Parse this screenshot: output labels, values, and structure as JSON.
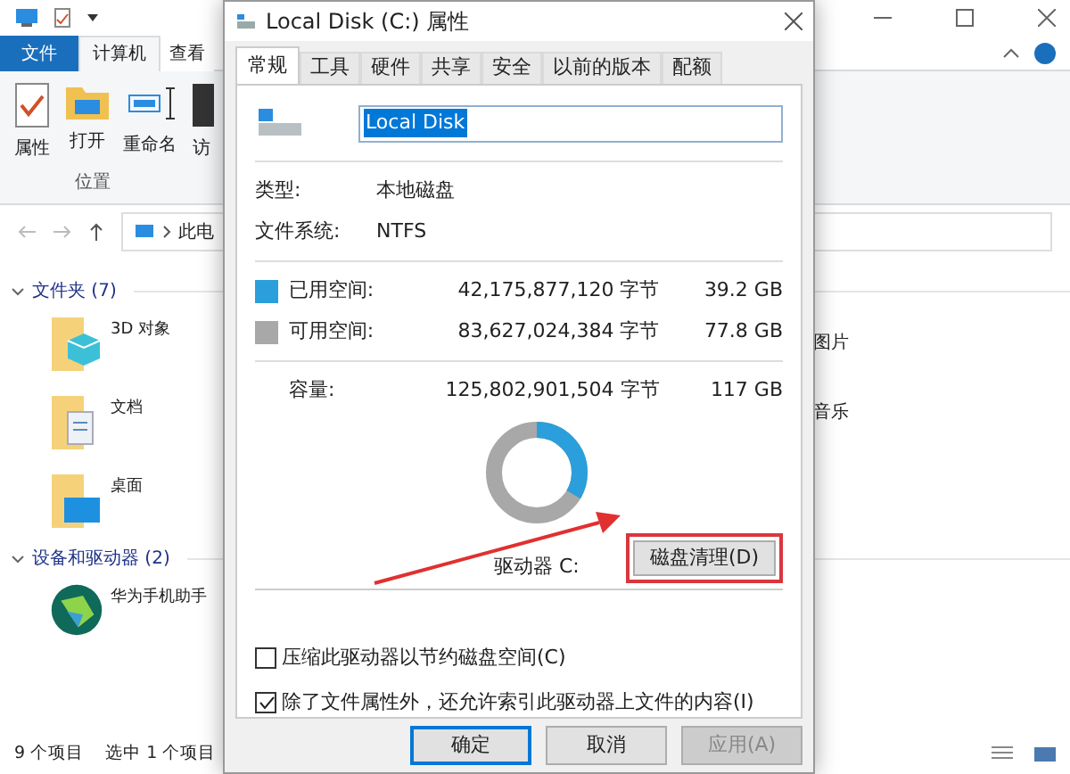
{
  "explorer": {
    "ribbon_tabs": [
      {
        "label": "文件",
        "kind": "file",
        "selected": false
      },
      {
        "label": "计算机",
        "kind": "tab",
        "selected": true
      },
      {
        "label": "查看",
        "kind": "tab",
        "selected": false
      }
    ],
    "ribbon_buttons": [
      {
        "label": "属性",
        "kind": "properties"
      },
      {
        "label": "打开",
        "kind": "open"
      },
      {
        "label": "重命名",
        "kind": "rename"
      },
      {
        "label": "访",
        "kind": "access"
      }
    ],
    "ribbon_group": "位置",
    "address": "此电",
    "sections": [
      {
        "title": "文件夹 (7)",
        "items": [
          {
            "label": "3D 对象",
            "kind": "cube"
          },
          {
            "label": "文档",
            "kind": "docs"
          },
          {
            "label": "桌面",
            "kind": "desktop"
          }
        ],
        "right_items": [
          "图片",
          "音乐"
        ]
      },
      {
        "title": "设备和驱动器 (2)",
        "items": [
          {
            "label": "华为手机助手",
            "kind": "app"
          }
        ]
      }
    ],
    "status": [
      "9 个项目",
      "选中 1 个项目"
    ]
  },
  "dialog": {
    "title": "Local Disk (C:) 属性",
    "tabs": [
      {
        "label": "常规",
        "selected": true
      },
      {
        "label": "工具",
        "selected": false
      },
      {
        "label": "硬件",
        "selected": false
      },
      {
        "label": "共享",
        "selected": false
      },
      {
        "label": "安全",
        "selected": false
      },
      {
        "label": "以前的版本",
        "selected": false
      },
      {
        "label": "配额",
        "selected": false
      }
    ],
    "name_field": {
      "value": "Local Disk"
    },
    "info": [
      {
        "label": "类型:",
        "value": "本地磁盘"
      },
      {
        "label": "文件系统:",
        "value": "NTFS"
      }
    ],
    "space": [
      {
        "label": "已用空间:",
        "bytes": "42,175,877,120 字节",
        "size": "39.2 GB",
        "color": "#2a9fdb"
      },
      {
        "label": "可用空间:",
        "bytes": "83,627,024,384 字节",
        "size": "77.8 GB",
        "color": "#a8a8a8"
      }
    ],
    "capacity": {
      "label": "容量:",
      "bytes": "125,802,901,504 字节",
      "size": "117 GB"
    },
    "usage": {
      "level": 0.335
    },
    "drive_label": "驱动器 C:",
    "cleanup_button": {
      "label": "磁盘清理(D)",
      "highlighted": true
    },
    "checkboxes": [
      {
        "label": "压缩此驱动器以节约磁盘空间(C)",
        "checked": false
      },
      {
        "label": "除了文件属性外，还允许索引此驱动器上文件的内容(I)",
        "checked": true
      }
    ],
    "buttons": [
      {
        "label": "确定",
        "default": true,
        "disabled": false
      },
      {
        "label": "取消",
        "default": false,
        "disabled": false
      },
      {
        "label": "应用(A)",
        "default": false,
        "disabled": true
      }
    ]
  }
}
